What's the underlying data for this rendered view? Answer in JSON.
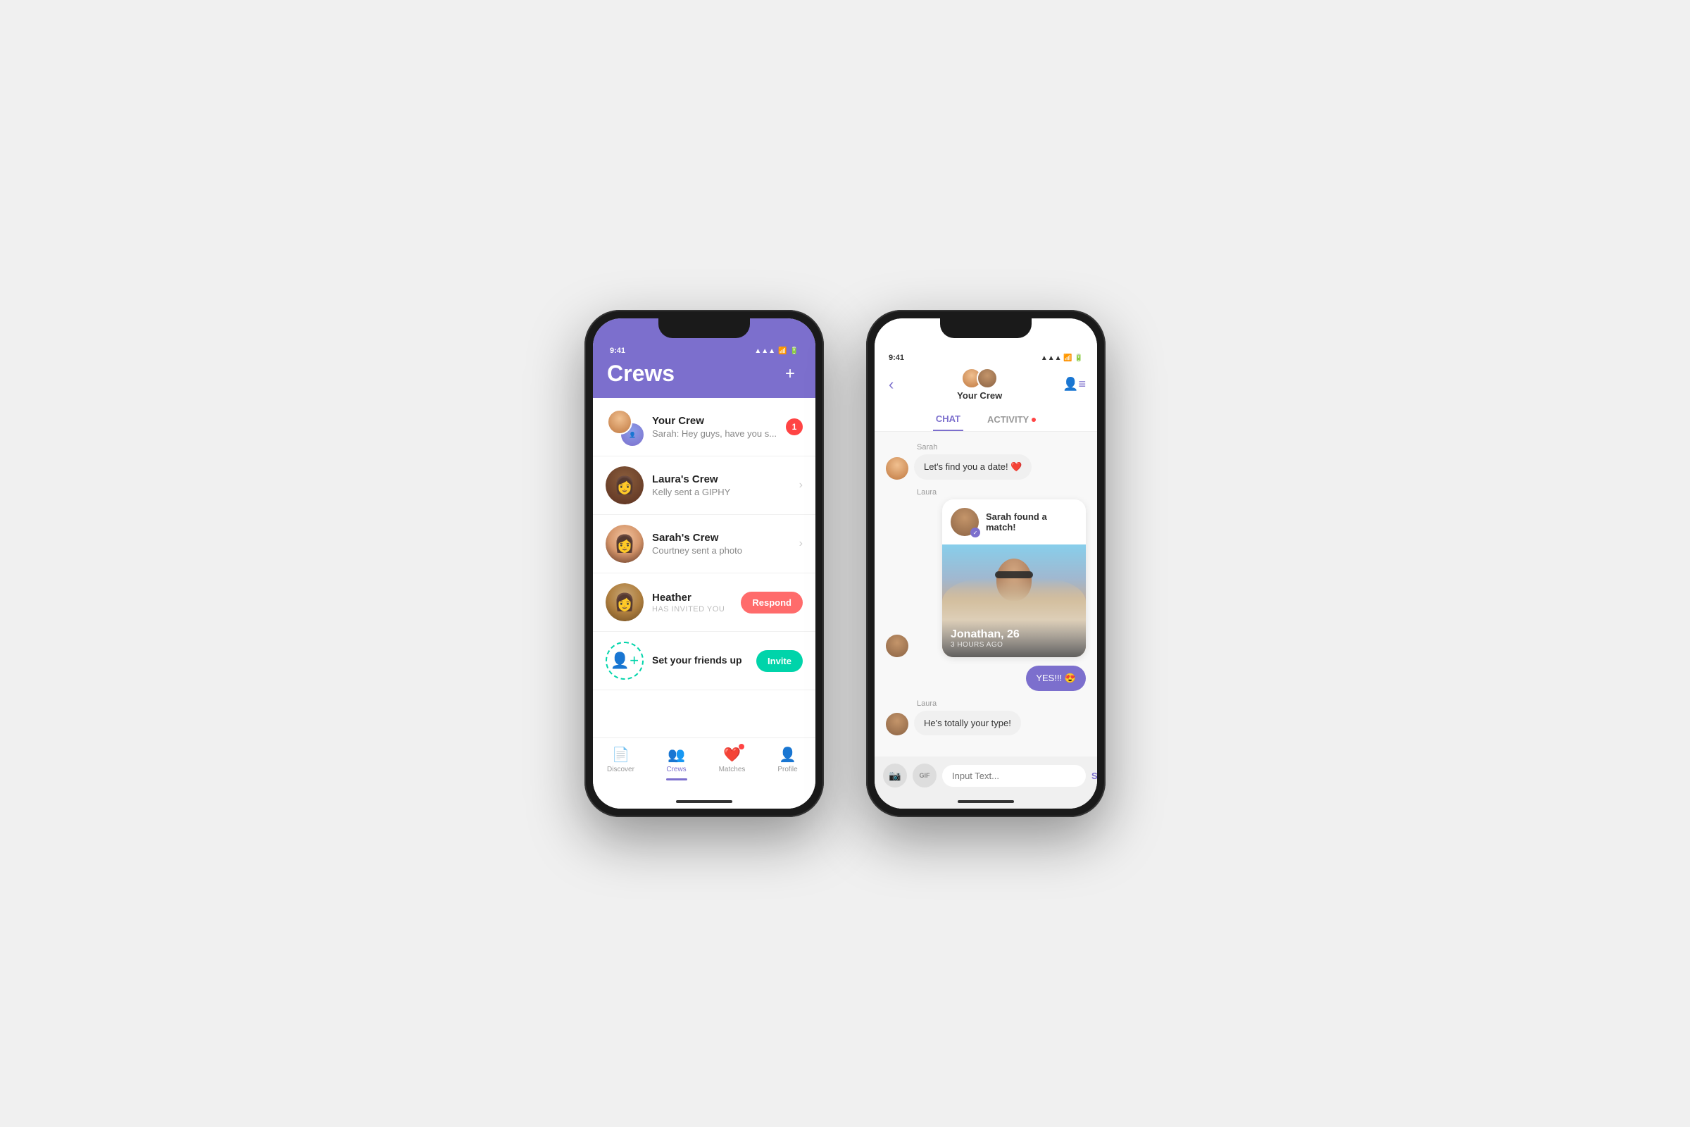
{
  "left_phone": {
    "status_time": "9:41",
    "header_title": "Crews",
    "add_btn": "+",
    "crew_items": [
      {
        "id": "your-crew",
        "name": "Your Crew",
        "sub": "Sarah: Hey guys, have you s...",
        "badge": "1",
        "avatar_type": "multi"
      },
      {
        "id": "lauras-crew",
        "name": "Laura's Crew",
        "sub": "Kelly sent a GIPHY",
        "badge": null,
        "avatar_type": "single"
      },
      {
        "id": "sarahs-crew",
        "name": "Sarah's Crew",
        "sub": "Courtney sent a photo",
        "badge": null,
        "avatar_type": "single"
      },
      {
        "id": "heather",
        "name": "Heather",
        "sub": "HAS INVITED YOU",
        "badge": null,
        "avatar_type": "single",
        "action": "Respond"
      },
      {
        "id": "set-friends",
        "name": "Set your friends up",
        "sub": null,
        "badge": null,
        "avatar_type": "add",
        "action": "Invite"
      }
    ],
    "bottom_nav": [
      {
        "id": "discover",
        "label": "Discover",
        "active": false
      },
      {
        "id": "crews",
        "label": "Crews",
        "active": true
      },
      {
        "id": "matches",
        "label": "Matches",
        "active": false,
        "dot": true
      },
      {
        "id": "profile",
        "label": "Profile",
        "active": false
      }
    ]
  },
  "right_phone": {
    "status_time": "9:41",
    "crew_name": "Your Crew",
    "tabs": [
      {
        "id": "chat",
        "label": "CHAT",
        "active": true
      },
      {
        "id": "activity",
        "label": "ACTIVITY",
        "active": false,
        "dot": true
      }
    ],
    "messages": [
      {
        "id": "msg1",
        "sender": "Sarah",
        "text": "Let's find you a date! ❤️",
        "type": "received"
      },
      {
        "id": "msg2",
        "sender": "Laura",
        "title": "Sarah found a match!",
        "type": "match-card",
        "match_name": "Jonathan, 26",
        "match_time": "3 HOURS AGO"
      },
      {
        "id": "msg3",
        "text": "YES!!! 😍",
        "type": "sent"
      },
      {
        "id": "msg4",
        "sender": "Laura",
        "text": "He's totally your type!",
        "type": "received"
      }
    ],
    "input_placeholder": "Input Text...",
    "send_label": "Send",
    "gif_label": "GIF"
  }
}
